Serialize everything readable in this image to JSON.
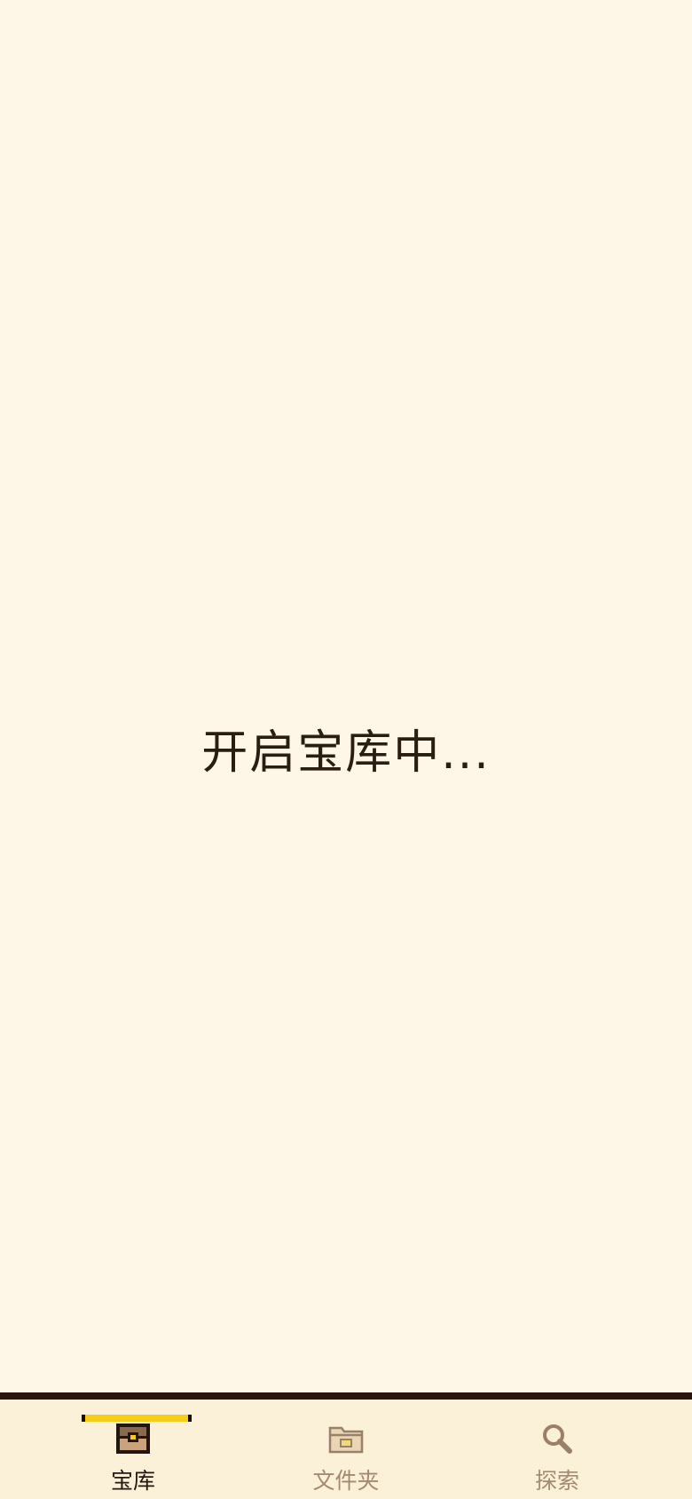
{
  "loading": {
    "text": "开启宝库中..."
  },
  "tabbar": {
    "tabs": [
      {
        "label": "宝库",
        "icon": "treasure-chest-icon",
        "active": true
      },
      {
        "label": "文件夹",
        "icon": "folder-icon",
        "active": false
      },
      {
        "label": "探索",
        "icon": "search-icon",
        "active": false
      }
    ]
  },
  "colors": {
    "background": "#fef7e7",
    "tabbar_background": "#fbf0d8",
    "tabbar_border": "#2a1410",
    "active_indicator": "#f5cd17",
    "active_label": "#231812",
    "inactive_label": "#a38a70"
  }
}
